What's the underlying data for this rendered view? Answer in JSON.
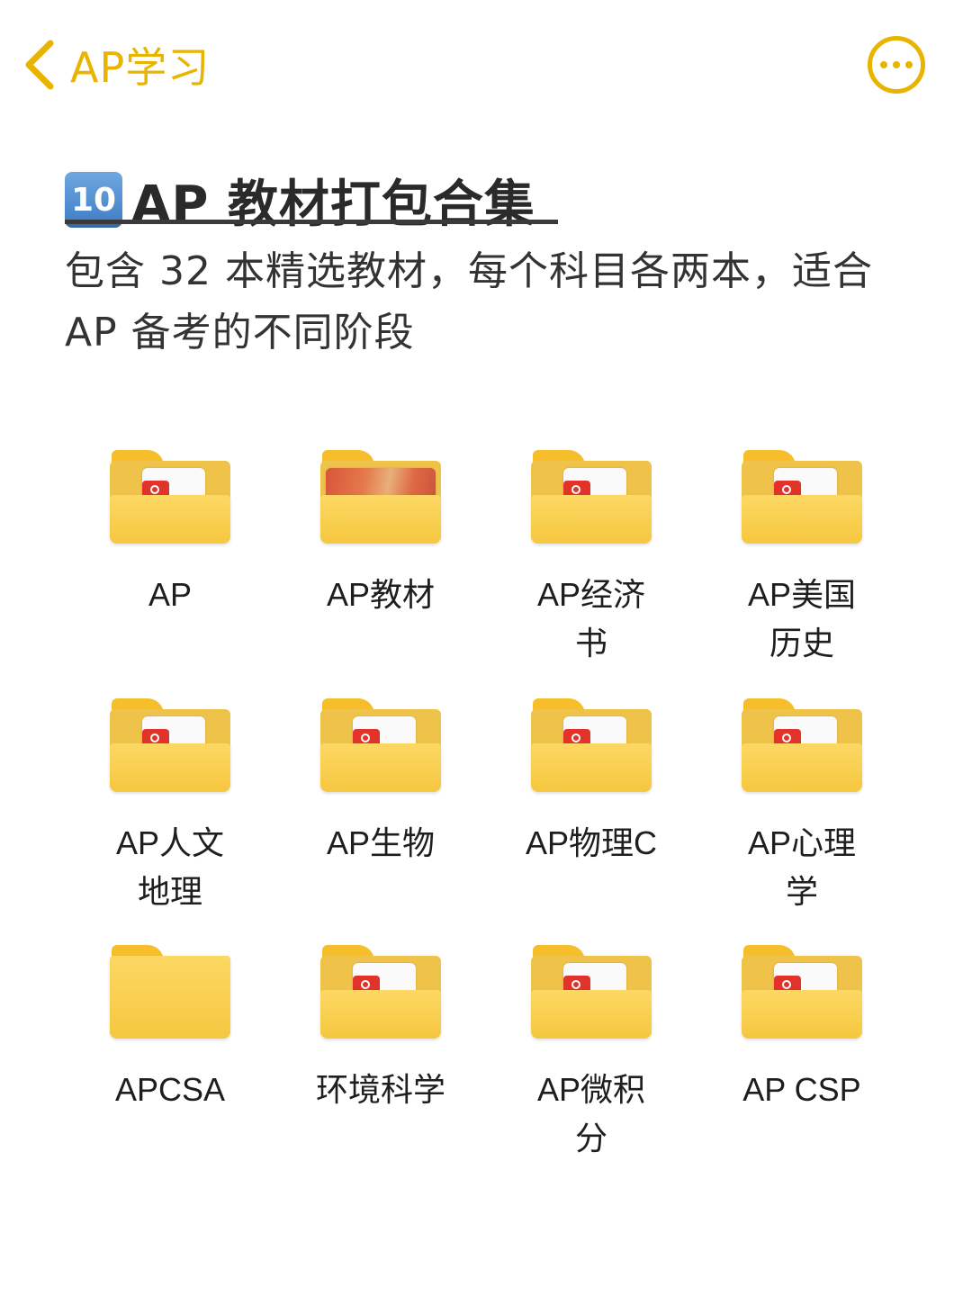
{
  "nav": {
    "title": "AP学习",
    "back_icon": "chevron-left-icon",
    "more_icon": "more-horizontal-icon",
    "accent_color": "#E9B400"
  },
  "heading": {
    "keycap": "10",
    "title": "AP 教材打包合集",
    "description": "包含 32 本精选教材，每个科目各两本，适合 AP 备考的不同阶段"
  },
  "folders": [
    {
      "label": "AP",
      "preview": "pdf"
    },
    {
      "label": "AP教材",
      "preview": "photo"
    },
    {
      "label": "AP经济书",
      "preview": "pdf"
    },
    {
      "label": "AP美国历史",
      "preview": "pdf"
    },
    {
      "label": "AP人文地理",
      "preview": "pdf"
    },
    {
      "label": "AP生物",
      "preview": "pdf"
    },
    {
      "label": "AP物理C",
      "preview": "pdf"
    },
    {
      "label": "AP心理学",
      "preview": "pdf"
    },
    {
      "label": "APCSA",
      "preview": "empty"
    },
    {
      "label": "环境科学",
      "preview": "pdf"
    },
    {
      "label": "AP微积分",
      "preview": "pdf"
    },
    {
      "label": "AP CSP",
      "preview": "pdf"
    }
  ]
}
